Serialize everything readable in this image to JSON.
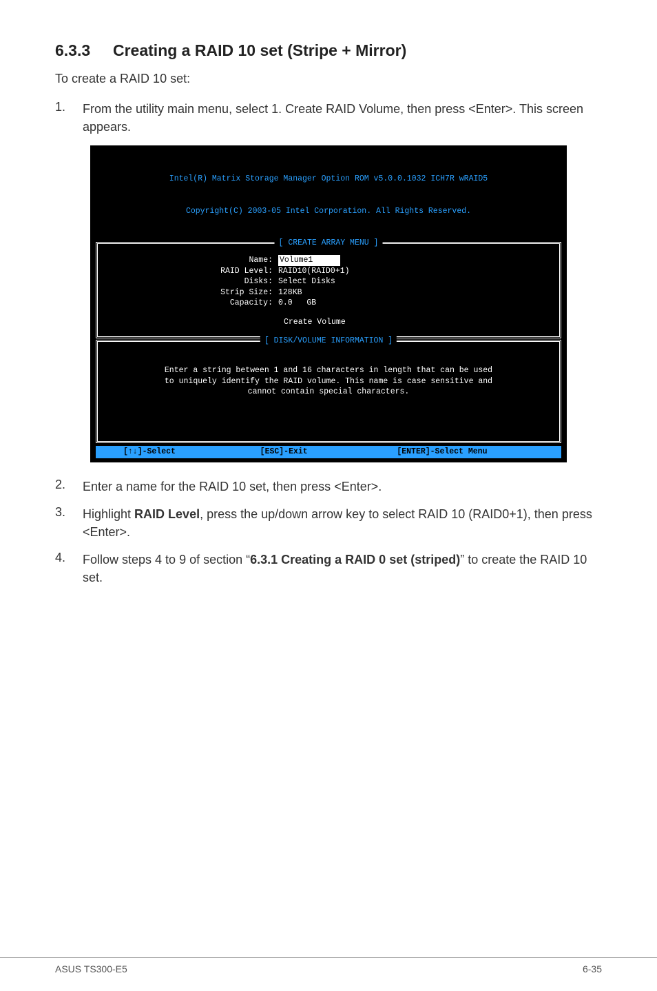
{
  "heading": {
    "number": "6.3.3",
    "title": "Creating a RAID 10 set (Stripe + Mirror)"
  },
  "intro": "To create a RAID 10 set:",
  "step1": "From the utility main menu, select 1. Create RAID Volume, then press <Enter>. This screen appears.",
  "terminal": {
    "header_line1": "Intel(R) Matrix Storage Manager Option ROM v5.0.0.1032 ICH7R wRAID5",
    "header_line2": "Copyright(C) 2003-05 Intel Corporation. All Rights Reserved.",
    "menu_title": "[ CREATE ARRAY MENU ]",
    "fields": {
      "name_label": "Name:",
      "name_value": "Volume1",
      "raid_level_label": "RAID Level:",
      "raid_level_value": "RAID10(RAID0+1)",
      "disks_label": "Disks:",
      "disks_value": "Select Disks",
      "strip_label": "Strip Size:",
      "strip_value": "128KB",
      "capacity_label": "Capacity:",
      "capacity_value": "0.0   GB"
    },
    "create_volume": "Create Volume",
    "info_title": "[ DISK/VOLUME INFORMATION ]",
    "info_text": "Enter a string between 1 and 16 characters in length that can be used\nto uniquely identify the RAID volume. This name is case sensitive and\ncannot contain special characters.",
    "footer": {
      "left": "[↑↓]-Select",
      "mid": "[ESC]-Exit",
      "right": "[ENTER]-Select Menu"
    }
  },
  "step2": "Enter a name for the RAID 10  set, then press <Enter>.",
  "step3_pre": "Highlight ",
  "step3_bold": "RAID Level",
  "step3_post": ", press the up/down arrow key to select RAID 10 (RAID0+1), then press <Enter>.",
  "step4_pre": "Follow steps 4 to 9 of section “",
  "step4_bold": "6.3.1 Creating a RAID 0 set (striped)",
  "step4_post": "” to create the RAID 10 set.",
  "footer_left": "ASUS TS300-E5",
  "footer_right": "6-35"
}
